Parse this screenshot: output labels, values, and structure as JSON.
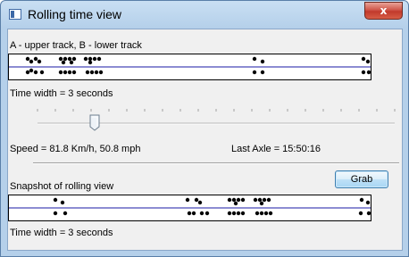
{
  "window": {
    "title": "Rolling time view",
    "close_glyph": "x"
  },
  "upper_panel": {
    "caption": "A - upper track, B - lower track",
    "time_width": "Time width = 3 seconds"
  },
  "readouts": {
    "speed": "Speed = 81.8 Km/h, 50.8 mph",
    "last_axle": "Last Axle = 15:50:16"
  },
  "slider": {
    "value_fraction": 0.16
  },
  "snapshot_panel": {
    "caption": "Snapshot of rolling view",
    "grab_label": "Grab",
    "time_width": "Time width = 3 seconds"
  },
  "colors": {
    "track_line": "#1a1aa6",
    "marker": "#000000"
  }
}
